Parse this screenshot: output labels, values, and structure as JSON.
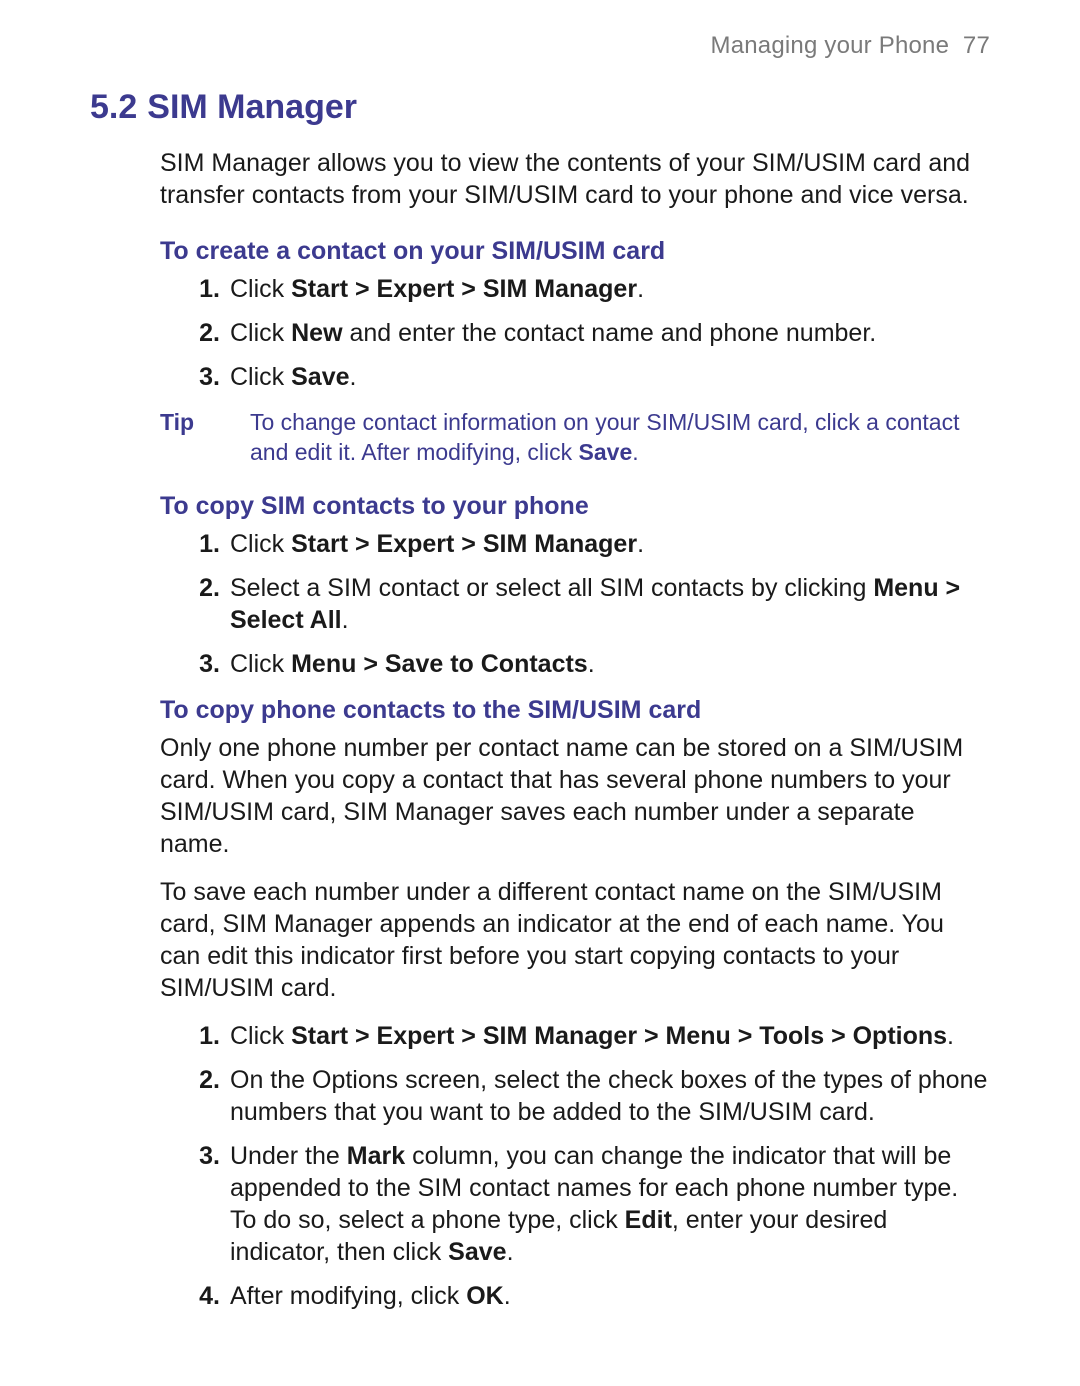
{
  "header": {
    "chapter": "Managing your Phone",
    "page_number": "77"
  },
  "section": {
    "number": "5.2",
    "title": "SIM Manager"
  },
  "intro": "SIM Manager allows you to view the contents of your SIM/USIM card and transfer contacts from your SIM/USIM card to your phone and vice versa.",
  "create": {
    "heading": "To create a contact on your SIM/USIM card",
    "steps": {
      "s1": {
        "a": "Click ",
        "b": "Start > Expert > SIM Manager",
        "c": "."
      },
      "s2": {
        "a": "Click ",
        "b": "New",
        "c": " and enter the contact name and phone number."
      },
      "s3": {
        "a": "Click ",
        "b": "Save",
        "c": "."
      }
    }
  },
  "tip": {
    "label": "Tip",
    "a": "To change contact information on your SIM/USIM card, click a contact and edit it. After modifying, click ",
    "b": "Save",
    "c": "."
  },
  "copy_to_phone": {
    "heading": "To copy SIM contacts to your phone",
    "steps": {
      "s1": {
        "a": "Click ",
        "b": "Start > Expert > SIM Manager",
        "c": "."
      },
      "s2": {
        "a": "Select a SIM contact or select all SIM contacts by clicking ",
        "b": "Menu > Select All",
        "c": "."
      },
      "s3": {
        "a": "Click ",
        "b": "Menu > Save to Contacts",
        "c": "."
      }
    }
  },
  "copy_to_sim": {
    "heading": "To copy phone contacts to the SIM/USIM card",
    "p1": "Only one phone number per contact name can be stored on a SIM/USIM card. When you copy a contact that has several phone numbers to your SIM/USIM card, SIM Manager saves each number under a separate name.",
    "p2": "To save each number under a different contact name on the SIM/USIM card, SIM Manager appends an indicator at the end of each name. You can edit this indicator first before you start copying contacts to your SIM/USIM card.",
    "steps": {
      "s1": {
        "a": "Click ",
        "b": "Start > Expert > SIM Manager > Menu > Tools > Options",
        "c": "."
      },
      "s2": {
        "a": "On the Options screen, select the check boxes of the types of phone numbers that you want to be added to the SIM/USIM card."
      },
      "s3": {
        "a": "Under the ",
        "b": "Mark",
        "c": " column, you can change the indicator that will be appended to the SIM contact names for each phone number type. To do so, select a phone type, click ",
        "d": "Edit",
        "e": ", enter your desired indicator, then click ",
        "f": "Save",
        "g": "."
      },
      "s4": {
        "a": "After modifying, click ",
        "b": "OK",
        "c": "."
      }
    }
  }
}
